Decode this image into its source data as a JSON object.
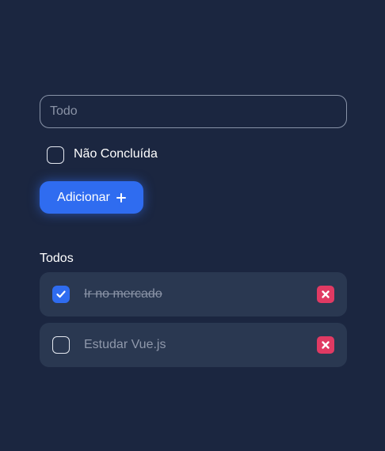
{
  "form": {
    "input_placeholder": "Todo",
    "input_value": "",
    "status_checkbox_checked": false,
    "status_label": "Não Concluída",
    "add_label": "Adicionar",
    "add_icon": "plus-icon"
  },
  "list": {
    "title": "Todos",
    "items": [
      {
        "text": "Ir no mercado",
        "done": true
      },
      {
        "text": "Estudar Vue.js",
        "done": false
      }
    ]
  },
  "colors": {
    "background": "#1b2640",
    "card": "#2a3851",
    "accent": "#2f6cf0",
    "delete": "#e03a63"
  },
  "icons": {
    "check": "check-icon",
    "delete": "close-icon"
  }
}
